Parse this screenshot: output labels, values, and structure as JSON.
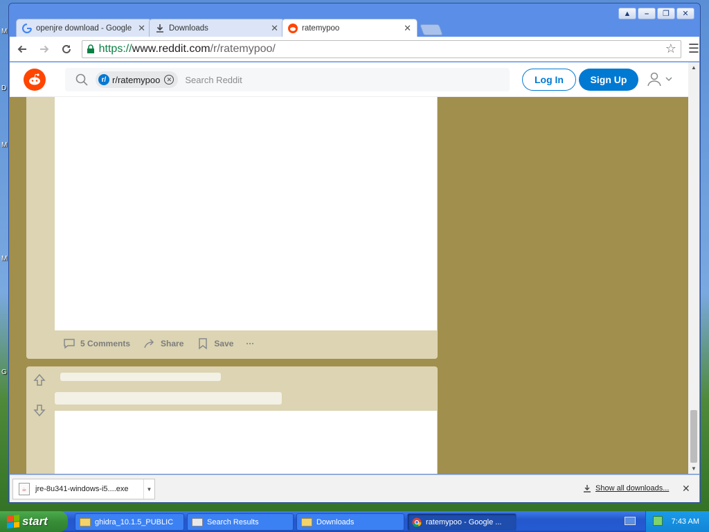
{
  "desktop": {
    "letters": [
      "M",
      "D",
      "M",
      "M",
      "G"
    ]
  },
  "window": {
    "title_buttons": [
      "▲",
      "–",
      "❐",
      "✕"
    ]
  },
  "tabs": [
    {
      "title": "openjre download - Google S",
      "icon": "google-g-icon"
    },
    {
      "title": "Downloads",
      "icon": "download-icon"
    },
    {
      "title": "ratemypoo",
      "icon": "reddit-icon",
      "active": true
    }
  ],
  "omnibox": {
    "scheme": "https://",
    "host": "www.reddit.com",
    "path": "/r/ratemypoo/"
  },
  "reddit": {
    "search_chip": "r/ratemypoo",
    "search_placeholder": "Search Reddit",
    "login": "Log In",
    "signup": "Sign Up"
  },
  "post1": {
    "comments": "5 Comments",
    "share": "Share",
    "save": "Save",
    "more": "···"
  },
  "download_shelf": {
    "file": "jre-8u341-windows-i5....exe",
    "show_all": "Show all downloads..."
  },
  "taskbar": {
    "start": "start",
    "items": [
      {
        "label": "ghidra_10.1.5_PUBLIC"
      },
      {
        "label": "Search Results"
      },
      {
        "label": "Downloads"
      },
      {
        "label": "ratemypoo - Google ..."
      }
    ],
    "clock": "7:43 AM"
  },
  "colors": {
    "accent": "#0079d3",
    "reddit_orange": "#ff4500",
    "page_bg": "#a18f4e",
    "post_bg": "#dcd4b2"
  }
}
